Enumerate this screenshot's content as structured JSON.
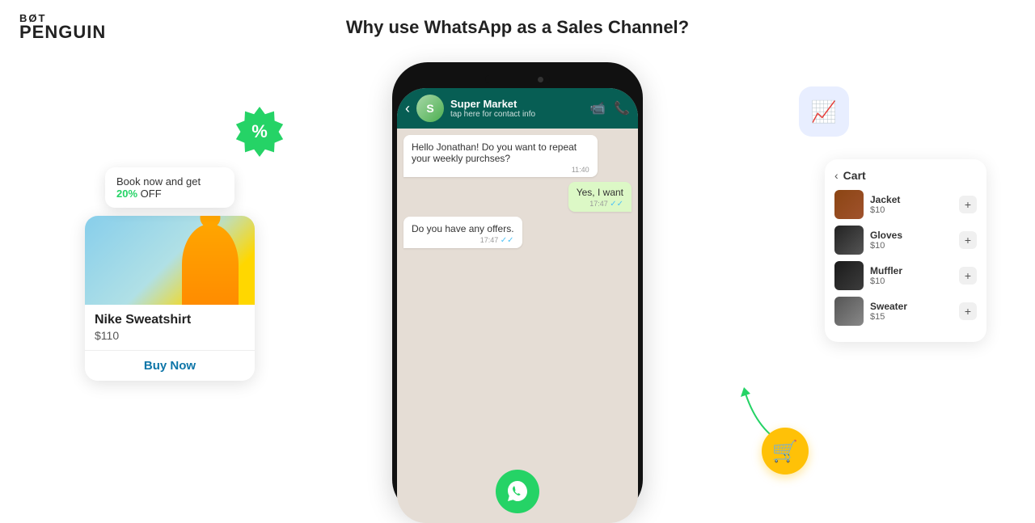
{
  "logo": {
    "top_text": "BØT",
    "bottom_text": "PENGUIN"
  },
  "page_title": "Why use WhatsApp as a Sales Channel?",
  "phone": {
    "contact_name": "Super Market",
    "contact_status": "tap here for contact info",
    "messages": [
      {
        "type": "received",
        "text": "Hello Jonathan! Do you want to repeat your weekly purchses?",
        "time": "11:40"
      },
      {
        "type": "sent",
        "text": "Yes, I want",
        "time": "17:47"
      },
      {
        "type": "received",
        "text": "Do you have any offers.",
        "time": "17:47"
      }
    ]
  },
  "product_card": {
    "name": "Nike Sweatshirt",
    "price": "$110",
    "buy_btn": "Buy Now"
  },
  "promo": {
    "text_before": "Book now and get ",
    "highlight": "20%",
    "text_after": " OFF"
  },
  "discount_seal": "%",
  "cart": {
    "title": "Cart",
    "items": [
      {
        "name": "Jacket",
        "price": "$10",
        "img_class": "cart-item-img-jacket"
      },
      {
        "name": "Gloves",
        "price": "$10",
        "img_class": "cart-item-img-gloves"
      },
      {
        "name": "Muffler",
        "price": "$10",
        "img_class": "cart-item-img-muffler"
      },
      {
        "name": "Sweater",
        "price": "$15",
        "img_class": "cart-item-img-sweater"
      }
    ]
  },
  "analytics": {
    "icon": "📈"
  },
  "cart_btn": {
    "icon": "🛒"
  },
  "whatsapp_icon": "💬"
}
